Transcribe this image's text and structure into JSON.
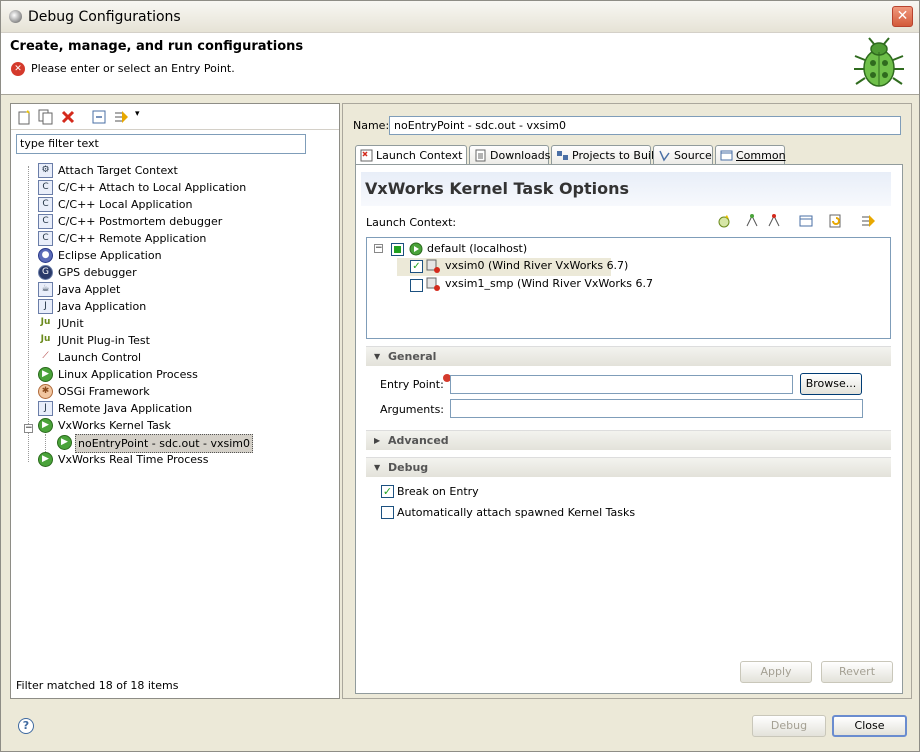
{
  "window": {
    "title": "Debug Configurations"
  },
  "header": {
    "heading": "Create, manage, and run configurations",
    "error_message": "Please enter or select an Entry Point."
  },
  "left": {
    "filter_placeholder": "type filter text",
    "tree": [
      {
        "label": "Attach Target Context",
        "icon": "attach-icon"
      },
      {
        "label": "C/C++ Attach to Local Application",
        "icon": "c-icon"
      },
      {
        "label": "C/C++ Local Application",
        "icon": "c-icon"
      },
      {
        "label": "C/C++ Postmortem debugger",
        "icon": "c-icon"
      },
      {
        "label": "C/C++ Remote Application",
        "icon": "c-icon"
      },
      {
        "label": "Eclipse Application",
        "icon": "eclipse-icon"
      },
      {
        "label": "GPS debugger",
        "icon": "gps-icon"
      },
      {
        "label": "Java Applet",
        "icon": "applet-icon"
      },
      {
        "label": "Java Application",
        "icon": "java-icon"
      },
      {
        "label": "JUnit",
        "icon": "junit-icon"
      },
      {
        "label": "JUnit Plug-in Test",
        "icon": "junit-icon"
      },
      {
        "label": "Launch Control",
        "icon": "launch-icon"
      },
      {
        "label": "Linux Application Process",
        "icon": "linux-icon"
      },
      {
        "label": "OSGi Framework",
        "icon": "osgi-icon"
      },
      {
        "label": "Remote Java Application",
        "icon": "remote-icon"
      },
      {
        "label": "VxWorks Kernel Task",
        "icon": "vxworks-icon"
      },
      {
        "label": "noEntryPoint - sdc.out - vxsim0",
        "icon": "vxworks-icon"
      },
      {
        "label": "VxWorks Real Time Process",
        "icon": "vxworks-icon"
      }
    ],
    "filter_info": "Filter matched 18 of 18 items"
  },
  "right": {
    "name_label": "Name:",
    "name_value": "noEntryPoint - sdc.out - vxsim0",
    "tabs": [
      {
        "label": "Launch Context"
      },
      {
        "label": "Downloads"
      },
      {
        "label": "Projects to Build"
      },
      {
        "label": "Source"
      },
      {
        "label": "Common"
      }
    ],
    "section_title": "VxWorks Kernel Task Options",
    "launch_context_label": "Launch Context:",
    "lc_tree": {
      "root": "default (localhost)",
      "children": [
        "vxsim0 (Wind River VxWorks 6.7)",
        "vxsim1_smp (Wind River VxWorks 6.7"
      ]
    },
    "general": {
      "title": "General",
      "entry_point_label": "Entry Point:",
      "browse_label": "Browse...",
      "arguments_label": "Arguments:"
    },
    "advanced": {
      "title": "Advanced"
    },
    "debug": {
      "title": "Debug",
      "break_on_entry": "Break on Entry",
      "auto_attach": "Automatically attach spawned Kernel Tasks"
    },
    "apply_label": "Apply",
    "revert_label": "Revert"
  },
  "footer": {
    "debug_label": "Debug",
    "close_label": "Close"
  }
}
